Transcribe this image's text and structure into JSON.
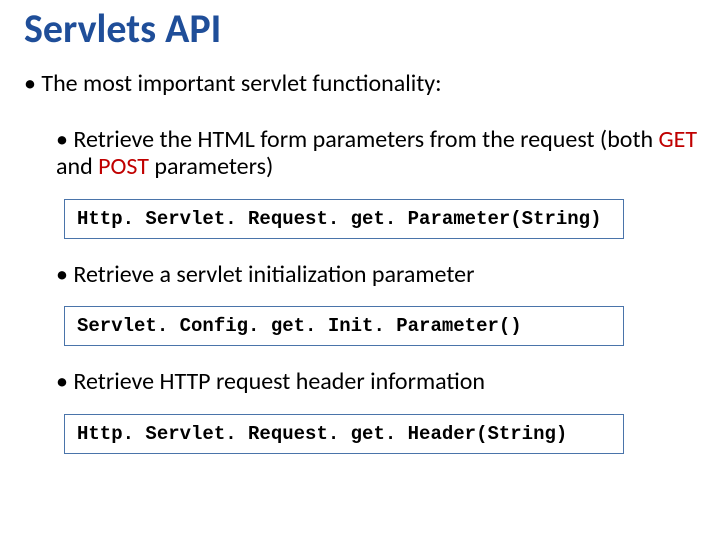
{
  "title": "Servlets API",
  "main_bullet": "• The most important servlet functionality:",
  "items": [
    {
      "prefix": "• Retrieve the HTML form parameters from the request (both ",
      "get": "GET",
      "mid": " and ",
      "post": "POST",
      "suffix": " parameters)",
      "code": "Http. Servlet. Request. get. Parameter(String)"
    },
    {
      "text": "• Retrieve a servlet initialization parameter",
      "code": "Servlet. Config. get. Init. Parameter()"
    },
    {
      "text": "• Retrieve HTTP request header information",
      "code": "Http. Servlet. Request. get. Header(String)"
    }
  ]
}
